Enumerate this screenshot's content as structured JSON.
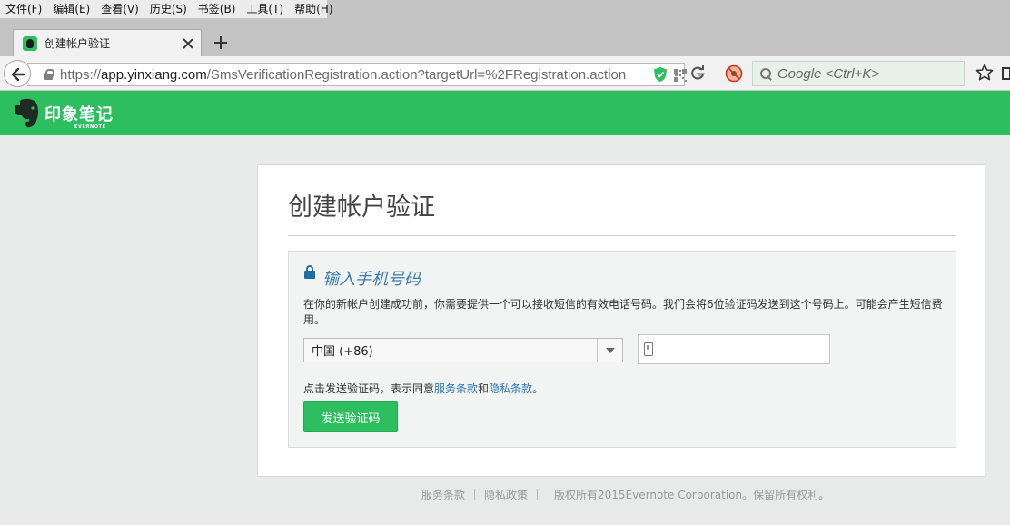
{
  "menu": [
    "文件(F)",
    "编辑(E)",
    "查看(V)",
    "历史(S)",
    "书签(B)",
    "工具(T)",
    "帮助(H)"
  ],
  "tab": {
    "title": "创建帐户验证"
  },
  "url": {
    "scheme": "https://",
    "host": "app.yinxiang.com",
    "path": "/SmsVerificationRegistration.action?targetUrl=%2FRegistration.action"
  },
  "search": {
    "placeholder": "Google <Ctrl+K>"
  },
  "brand": {
    "name": "印象笔记",
    "sub": "EVERNOTE",
    "color": "#2dbe60"
  },
  "page": {
    "title": "创建帐户验证",
    "panel_heading": "输入手机号码",
    "panel_desc": "在你的新帐户创建成功前，你需要提供一个可以接收短信的有效电话号码。我们会将6位验证码发送到这个号码上。可能会产生短信费用。",
    "country_value": "中国 (+86)",
    "phone_value": "",
    "terms_prefix": "点击发送验证码，表示同意",
    "terms_link1": "服务条款",
    "terms_and": "和",
    "terms_link2": "隐私条款",
    "terms_suffix": "。",
    "send_button": "发送验证码"
  },
  "footer": {
    "terms": "服务条款",
    "privacy": "隐私政策",
    "copyright": "版权所有2015Evernote Corporation。保留所有权利。"
  }
}
